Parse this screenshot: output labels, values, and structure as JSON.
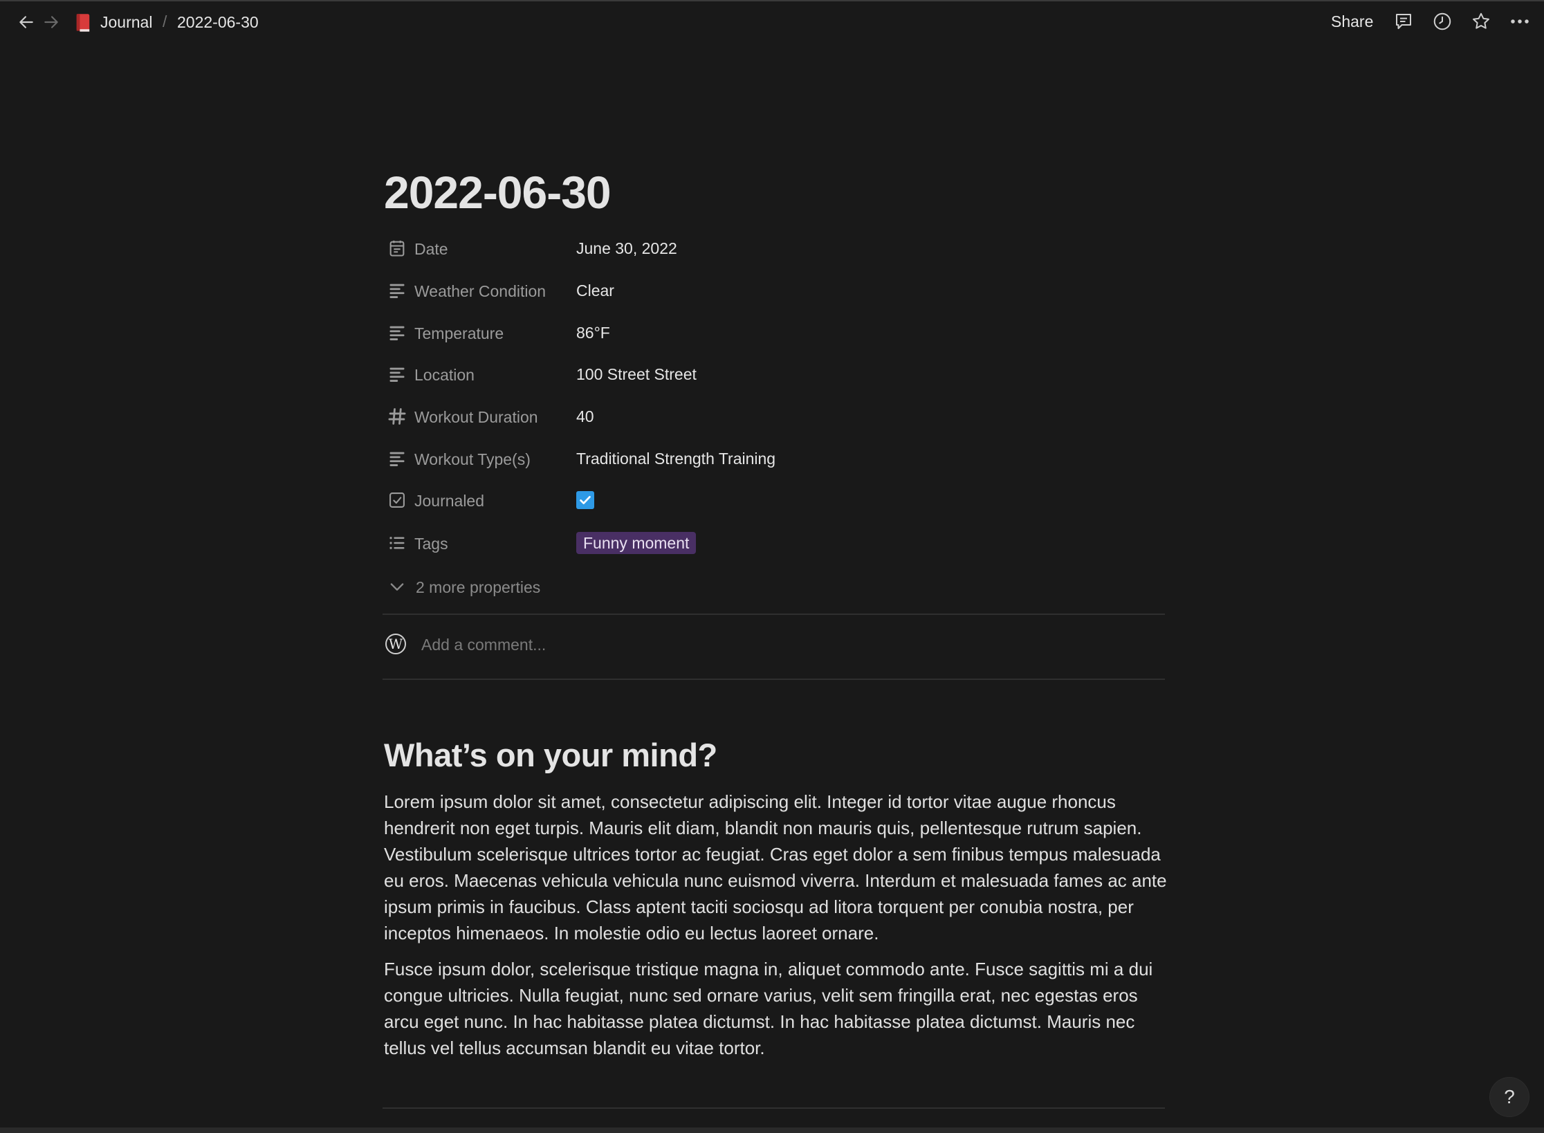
{
  "breadcrumb": {
    "parent": "Journal",
    "separator": "/",
    "current": "2022-06-30"
  },
  "topbar": {
    "share_label": "Share",
    "icons": [
      "comments-icon",
      "history-icon",
      "favorite-star-icon",
      "more-options-icon"
    ]
  },
  "page": {
    "title": "2022-06-30"
  },
  "properties": [
    {
      "icon": "calendar-icon",
      "name": "Date",
      "value": "June 30, 2022"
    },
    {
      "icon": "text-lines-icon",
      "name": "Weather Condition",
      "value": "Clear"
    },
    {
      "icon": "text-lines-icon",
      "name": "Temperature",
      "value": "86°F"
    },
    {
      "icon": "text-lines-icon",
      "name": "Location",
      "value": "100 Street Street"
    },
    {
      "icon": "hash-icon",
      "name": "Workout Duration",
      "value": "40"
    },
    {
      "icon": "text-lines-icon",
      "name": "Workout Type(s)",
      "value": "Traditional Strength Training"
    },
    {
      "icon": "checkbox-icon",
      "name": "Journaled",
      "checked": true
    },
    {
      "icon": "list-icon",
      "name": "Tags",
      "tag": "Funny moment"
    }
  ],
  "more_properties": "2 more properties",
  "comment": {
    "avatar_letter": "W",
    "placeholder": "Add a comment..."
  },
  "body": {
    "heading": "What’s on your mind?",
    "paragraphs": [
      "Lorem ipsum dolor sit amet, consectetur adipiscing elit. Integer id tortor vitae augue rhoncus hendrerit non eget turpis. Mauris elit diam, blandit non mauris quis, pellentesque rutrum sapien. Vestibulum scelerisque ultrices tortor ac feugiat. Cras eget dolor a sem finibus tempus malesuada eu eros. Maecenas vehicula vehicula nunc euismod viverra. Interdum et malesuada fames ac ante ipsum primis in faucibus. Class aptent taciti sociosqu ad litora torquent per conubia nostra, per inceptos himenaeos. In molestie odio eu lectus laoreet ornare.",
      "Fusce ipsum dolor, scelerisque tristique magna in, aliquet commodo ante. Fusce sagittis mi a dui congue ultricies. Nulla feugiat, nunc sed ornare varius, velit sem fringilla erat, nec egestas eros arcu eget nunc. In hac habitasse platea dictumst. In hac habitasse platea dictumst. Mauris nec tellus vel tellus accumsan blandit eu vitae tortor."
    ]
  },
  "help_label": "?",
  "colors": {
    "background": "#191919",
    "tag_bg": "#492f64",
    "checkbox": "#2e9ae6",
    "page_icon": "#e03e3e"
  }
}
